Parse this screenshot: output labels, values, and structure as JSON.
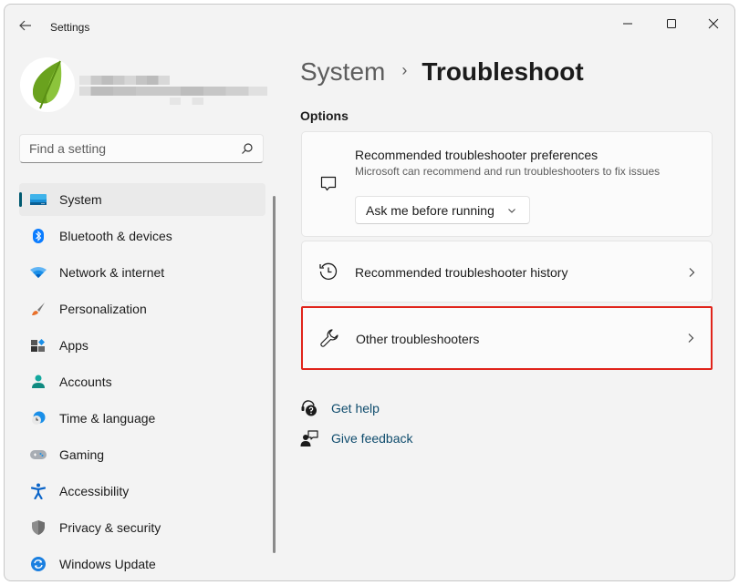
{
  "window": {
    "app_title": "Settings",
    "controls": {
      "minimize": "minimize-icon",
      "maximize": "maximize-icon",
      "close": "close-icon"
    }
  },
  "profile": {
    "avatar_icon": "leaf-icon",
    "name_obscured": true
  },
  "search": {
    "placeholder": "Find a setting",
    "value": "",
    "icon": "search-icon"
  },
  "sidebar": {
    "items": [
      {
        "label": "System",
        "icon": "system-display-icon",
        "active": true,
        "color": "#0078d4"
      },
      {
        "label": "Bluetooth & devices",
        "icon": "bluetooth-icon",
        "active": false,
        "color": "#0a7cff"
      },
      {
        "label": "Network & internet",
        "icon": "wifi-icon",
        "active": false,
        "color": "#0a7cff"
      },
      {
        "label": "Personalization",
        "icon": "paintbrush-icon",
        "active": false,
        "color": "#e8702a"
      },
      {
        "label": "Apps",
        "icon": "apps-icon",
        "active": false,
        "color": "#4a4a4a"
      },
      {
        "label": "Accounts",
        "icon": "account-icon",
        "active": false,
        "color": "#13a89e"
      },
      {
        "label": "Time & language",
        "icon": "globe-clock-icon",
        "active": false,
        "color": "#0a7cff"
      },
      {
        "label": "Gaming",
        "icon": "gamepad-icon",
        "active": false,
        "color": "#9aa0a6"
      },
      {
        "label": "Accessibility",
        "icon": "accessibility-icon",
        "active": false,
        "color": "#0a64c8"
      },
      {
        "label": "Privacy & security",
        "icon": "shield-icon",
        "active": false,
        "color": "#8a8a8a"
      },
      {
        "label": "Windows Update",
        "icon": "update-icon",
        "active": false,
        "color": "#0a7cff"
      }
    ]
  },
  "main": {
    "breadcrumb": {
      "parent": "System",
      "separator": "›",
      "current": "Troubleshoot"
    },
    "section_title": "Options",
    "cards": {
      "preferences": {
        "title": "Recommended troubleshooter preferences",
        "description": "Microsoft can recommend and run troubleshooters to fix issues",
        "icon": "chat-bubble-icon",
        "dropdown_value": "Ask me before running"
      },
      "history": {
        "title": "Recommended troubleshooter history",
        "icon": "history-icon"
      },
      "other": {
        "title": "Other troubleshooters",
        "icon": "wrench-icon",
        "highlighted": true,
        "highlight_color": "#e0241b"
      }
    },
    "links": [
      {
        "label": "Get help",
        "icon": "help-icon"
      },
      {
        "label": "Give feedback",
        "icon": "feedback-icon"
      }
    ]
  }
}
